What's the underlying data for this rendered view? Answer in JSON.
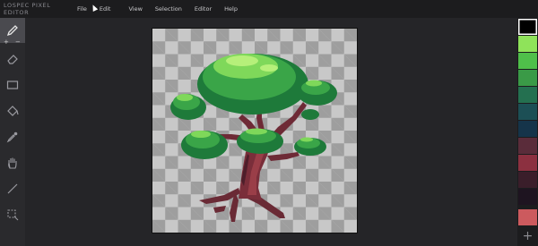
{
  "app": {
    "title": "LOSPEC PIXEL EDITOR"
  },
  "menu": [
    {
      "label": "File"
    },
    {
      "label": "Edit"
    },
    {
      "label": "View"
    },
    {
      "label": "Selection"
    },
    {
      "label": "Editor"
    },
    {
      "label": "Help"
    }
  ],
  "toolbar": {
    "size_plus": "+",
    "size_minus": "−",
    "tools": [
      {
        "name": "pencil-tool",
        "icon": "pencil-icon",
        "active": true
      },
      {
        "name": "eraser-tool",
        "icon": "eraser-icon"
      },
      {
        "name": "rectangle-tool",
        "icon": "rectangle-icon"
      },
      {
        "name": "fill-bucket-tool",
        "icon": "paint-bucket-icon"
      },
      {
        "name": "eyedropper-tool",
        "icon": "eyedropper-icon"
      },
      {
        "name": "pan-tool",
        "icon": "hand-icon"
      },
      {
        "name": "line-tool",
        "icon": "line-icon"
      },
      {
        "name": "selection-tool",
        "icon": "marquee-select-icon"
      }
    ]
  },
  "palette": {
    "colors": [
      "#000000",
      "#8fe35a",
      "#4fbf4a",
      "#3a9a47",
      "#247050",
      "#1c4f55",
      "#15344a",
      "#5a2c3a",
      "#8c3040",
      "#3a1e2a",
      "#1e1420",
      "#cc5a5e"
    ],
    "add_label": "+"
  },
  "canvas": {
    "content": "pixel-art tree on transparent background"
  }
}
